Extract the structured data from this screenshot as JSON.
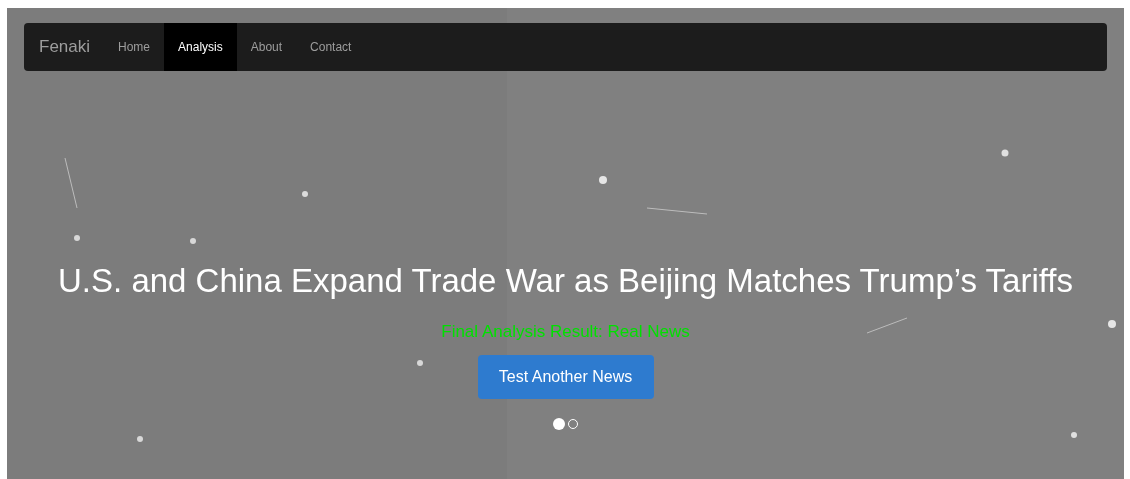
{
  "navbar": {
    "brand": "Fenaki",
    "items": [
      {
        "label": "Home",
        "selected": false
      },
      {
        "label": "Analysis",
        "selected": true
      },
      {
        "label": "About",
        "selected": false
      },
      {
        "label": "Contact",
        "selected": false
      }
    ]
  },
  "hero": {
    "headline": "U.S. and China Expand Trade War as Beijing Matches Trump’s Tariffs",
    "result": "Final Analysis Result: Real News",
    "button": "Test Another News",
    "indicators": [
      {
        "selected": true
      },
      {
        "selected": false
      }
    ]
  }
}
